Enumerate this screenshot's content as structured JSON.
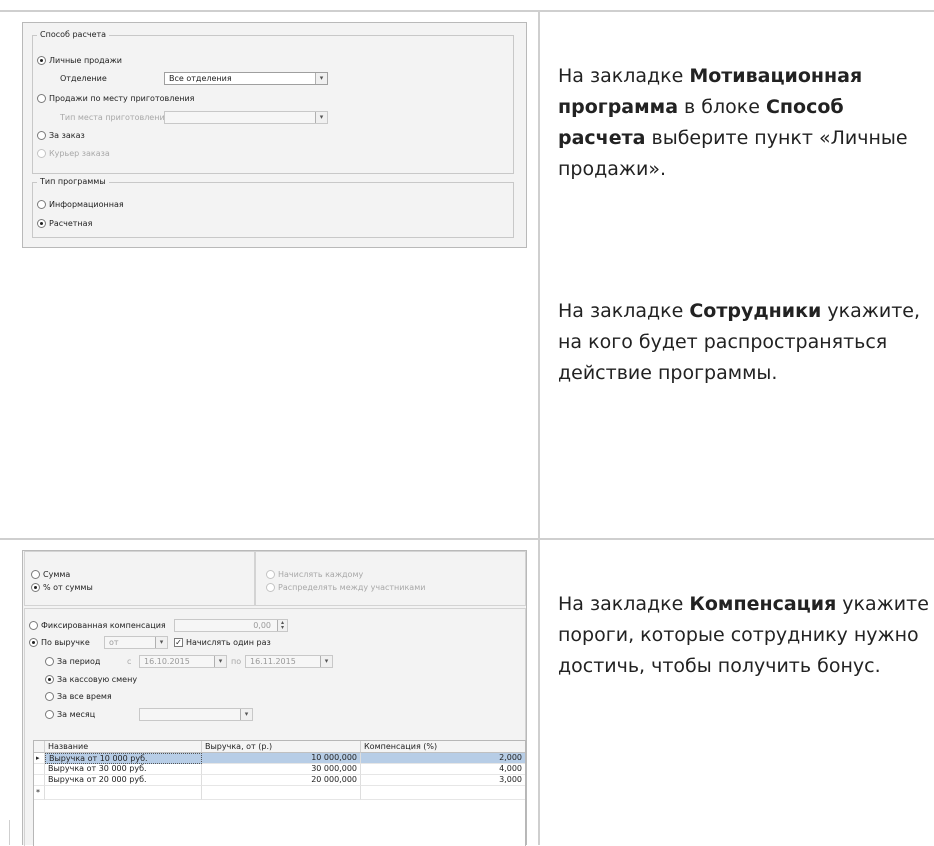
{
  "row1": {
    "text": {
      "p1_prefix": "На закладке ",
      "p1_bold1": "Мотивационная программа",
      "p1_mid": " в блоке ",
      "p1_bold2": "Способ расчета",
      "p1_suffix": " выберите пункт «Личные продажи».",
      "p2_prefix": "На закладке ",
      "p2_bold": "Сотрудники",
      "p2_suffix": " укажите, на кого будет распространяться действие программы."
    },
    "screenshot": {
      "calc_group_title": "Способ расчета",
      "personal_sales": "Личные продажи",
      "department_label": "Отделение",
      "department_value": "Все отделения",
      "place_sales": "Продажи по месту приготовления",
      "place_type_label": "Тип места приготовления",
      "per_order": "За заказ",
      "courier": "Курьер заказа",
      "program_type_title": "Тип программы",
      "informational": "Информационная",
      "calculated": "Расчетная"
    }
  },
  "row2": {
    "text": {
      "prefix": "На закладке ",
      "bold": "Компенсация",
      "suffix": " укажите пороги, которые сотруднику нужно достичь, чтобы получить бонус."
    },
    "screenshot": {
      "sum": "Сумма",
      "percent_of_sum": "% от суммы",
      "charge_each": "Начислять каждому",
      "distribute": "Распределять между участниками",
      "fixed_comp": "Фиксированная компенсация",
      "fixed_value": "0,00",
      "by_revenue": "По выручке",
      "revenue_from": "от",
      "charge_once": "Начислять один раз",
      "for_period": "За период",
      "from_label": "с",
      "date_from": "16.10.2015",
      "to_label": "по",
      "date_to": "16.11.2015",
      "for_shift": "За кассовую смену",
      "for_all_time": "За все время",
      "for_month": "За месяц",
      "columns": [
        "Название",
        "Выручка, от (р.)",
        "Компенсация (%)"
      ],
      "rows": [
        [
          "Выручка от 10 000 руб.",
          "10 000,000",
          "2,000"
        ],
        [
          "Выручка от 30 000 руб.",
          "30 000,000",
          "4,000"
        ],
        [
          "Выручка от 20 000 руб.",
          "20 000,000",
          "3,000"
        ]
      ],
      "new_row_marker": "*",
      "current_row_marker": "▸"
    }
  }
}
